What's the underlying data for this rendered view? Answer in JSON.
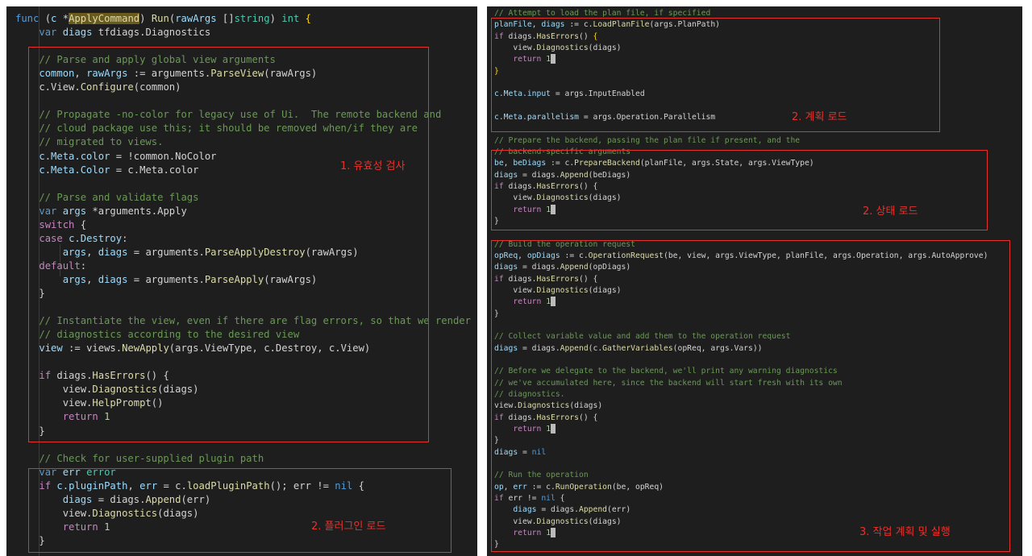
{
  "left_panel": {
    "lines": [
      [
        [
          "kw",
          "func"
        ],
        [
          "p",
          " ("
        ],
        [
          "var",
          "c"
        ],
        [
          "p",
          " *"
        ],
        [
          "hl",
          "ApplyCommand"
        ],
        [
          "p",
          ") "
        ],
        [
          "fn",
          "Run"
        ],
        [
          "p",
          "("
        ],
        [
          "var",
          "rawArgs"
        ],
        [
          "p",
          " []"
        ],
        [
          "type",
          "string"
        ],
        [
          "p",
          ") "
        ],
        [
          "type",
          "int"
        ],
        [
          "br",
          " {"
        ]
      ],
      [
        [
          "p",
          "    "
        ],
        [
          "kw",
          "var"
        ],
        [
          "p",
          " "
        ],
        [
          "var",
          "diags"
        ],
        [
          "p",
          " tfdiags.Diagnostics"
        ]
      ],
      [],
      [
        [
          "cmt",
          "    // Parse and apply global view arguments"
        ]
      ],
      [
        [
          "p",
          "    "
        ],
        [
          "var",
          "common"
        ],
        [
          "p",
          ", "
        ],
        [
          "var",
          "rawArgs"
        ],
        [
          "p",
          " := arguments."
        ],
        [
          "fn",
          "ParseView"
        ],
        [
          "p",
          "(rawArgs)"
        ]
      ],
      [
        [
          "p",
          "    c.View."
        ],
        [
          "fn",
          "Configure"
        ],
        [
          "p",
          "(common)"
        ]
      ],
      [],
      [
        [
          "cmt",
          "    // Propagate -no-color for legacy use of Ui.  The remote backend and"
        ]
      ],
      [
        [
          "cmt",
          "    // cloud package use this; it should be removed when/if they are"
        ]
      ],
      [
        [
          "cmt",
          "    // migrated to views."
        ]
      ],
      [
        [
          "p",
          "    "
        ],
        [
          "var",
          "c.Meta.color"
        ],
        [
          "p",
          " = !common.NoColor"
        ]
      ],
      [
        [
          "p",
          "    "
        ],
        [
          "var",
          "c.Meta.Color"
        ],
        [
          "p",
          " = c.Meta.color"
        ]
      ],
      [],
      [
        [
          "cmt",
          "    // Parse and validate flags"
        ]
      ],
      [
        [
          "p",
          "    "
        ],
        [
          "kw",
          "var"
        ],
        [
          "p",
          " "
        ],
        [
          "var",
          "args"
        ],
        [
          "p",
          " *arguments.Apply"
        ]
      ],
      [
        [
          "p",
          "    "
        ],
        [
          "ctl",
          "switch"
        ],
        [
          "p",
          " {"
        ]
      ],
      [
        [
          "p",
          "    "
        ],
        [
          "ctl",
          "case"
        ],
        [
          "p",
          " "
        ],
        [
          "var",
          "c.Destroy"
        ],
        [
          "p",
          ":"
        ]
      ],
      [
        [
          "p",
          "        "
        ],
        [
          "var",
          "args"
        ],
        [
          "p",
          ", "
        ],
        [
          "var",
          "diags"
        ],
        [
          "p",
          " = arguments."
        ],
        [
          "fn",
          "ParseApplyDestroy"
        ],
        [
          "p",
          "(rawArgs)"
        ]
      ],
      [
        [
          "p",
          "    "
        ],
        [
          "ctl",
          "default"
        ],
        [
          "p",
          ":"
        ]
      ],
      [
        [
          "p",
          "        "
        ],
        [
          "var",
          "args"
        ],
        [
          "p",
          ", "
        ],
        [
          "var",
          "diags"
        ],
        [
          "p",
          " = arguments."
        ],
        [
          "fn",
          "ParseApply"
        ],
        [
          "p",
          "(rawArgs)"
        ]
      ],
      [
        [
          "p",
          "    }"
        ]
      ],
      [],
      [
        [
          "cmt",
          "    // Instantiate the view, even if there are flag errors, so that we render"
        ]
      ],
      [
        [
          "cmt",
          "    // diagnostics according to the desired view"
        ]
      ],
      [
        [
          "p",
          "    "
        ],
        [
          "var",
          "view"
        ],
        [
          "p",
          " := views."
        ],
        [
          "fn",
          "NewApply"
        ],
        [
          "p",
          "(args.ViewType, c.Destroy, c.View)"
        ]
      ],
      [],
      [
        [
          "p",
          "    "
        ],
        [
          "ctl",
          "if"
        ],
        [
          "p",
          " diags."
        ],
        [
          "fn",
          "HasErrors"
        ],
        [
          "p",
          "() {"
        ]
      ],
      [
        [
          "p",
          "        view."
        ],
        [
          "fn",
          "Diagnostics"
        ],
        [
          "p",
          "(diags)"
        ]
      ],
      [
        [
          "p",
          "        view."
        ],
        [
          "fn",
          "HelpPrompt"
        ],
        [
          "p",
          "()"
        ]
      ],
      [
        [
          "p",
          "        "
        ],
        [
          "ctl",
          "return"
        ],
        [
          "p",
          " "
        ],
        [
          "num",
          "1"
        ]
      ],
      [
        [
          "p",
          "    }"
        ]
      ],
      [],
      [
        [
          "cmt",
          "    // Check for user-supplied plugin path"
        ]
      ],
      [
        [
          "p",
          "    "
        ],
        [
          "kw",
          "var"
        ],
        [
          "p",
          " "
        ],
        [
          "var",
          "err"
        ],
        [
          "p",
          " "
        ],
        [
          "type",
          "error"
        ]
      ],
      [
        [
          "p",
          "    "
        ],
        [
          "ctl",
          "if"
        ],
        [
          "p",
          " "
        ],
        [
          "var",
          "c.pluginPath"
        ],
        [
          "p",
          ", "
        ],
        [
          "var",
          "err"
        ],
        [
          "p",
          " = c."
        ],
        [
          "fn",
          "loadPluginPath"
        ],
        [
          "p",
          "(); err != "
        ],
        [
          "kw",
          "nil"
        ],
        [
          "p",
          " {"
        ]
      ],
      [
        [
          "p",
          "        "
        ],
        [
          "var",
          "diags"
        ],
        [
          "p",
          " = diags."
        ],
        [
          "fn",
          "Append"
        ],
        [
          "p",
          "(err)"
        ]
      ],
      [
        [
          "p",
          "        view."
        ],
        [
          "fn",
          "Diagnostics"
        ],
        [
          "p",
          "(diags)"
        ]
      ],
      [
        [
          "p",
          "        "
        ],
        [
          "ctl",
          "return"
        ],
        [
          "p",
          " "
        ],
        [
          "num",
          "1"
        ]
      ],
      [
        [
          "p",
          "    }"
        ]
      ]
    ],
    "annotations": [
      "1. 유효성 검사",
      "2. 플러그인 로드"
    ]
  },
  "right_panel": {
    "lines": [
      [
        [
          "cmt",
          "// Attempt to load the plan file, if specified"
        ]
      ],
      [
        [
          "var",
          "planFile"
        ],
        [
          "p",
          ", "
        ],
        [
          "var",
          "diags"
        ],
        [
          "p",
          " := c."
        ],
        [
          "fn",
          "LoadPlanFile"
        ],
        [
          "p",
          "(args.PlanPath)"
        ]
      ],
      [
        [
          "ctl",
          "if"
        ],
        [
          "p",
          " diags."
        ],
        [
          "fn",
          "HasErrors"
        ],
        [
          "p",
          "() "
        ],
        [
          "br",
          "{"
        ]
      ],
      [
        [
          "p",
          "    view."
        ],
        [
          "fn",
          "Diagnostics"
        ],
        [
          "p",
          "(diags)"
        ]
      ],
      [
        [
          "p",
          "    "
        ],
        [
          "ctl",
          "return"
        ],
        [
          "p",
          " "
        ],
        [
          "num",
          "1"
        ],
        [
          "caret",
          ""
        ]
      ],
      [
        [
          "br",
          "}"
        ]
      ],
      [],
      [
        [
          "var",
          "c.Meta.input"
        ],
        [
          "p",
          " = args.InputEnabled"
        ]
      ],
      [],
      [
        [
          "var",
          "c.Meta.parallelism"
        ],
        [
          "p",
          " = args.Operation.Parallelism"
        ]
      ],
      [],
      [
        [
          "cmt",
          "// Prepare the backend, passing the plan file if present, and the"
        ]
      ],
      [
        [
          "cmt",
          "// backend-specific arguments"
        ]
      ],
      [
        [
          "var",
          "be"
        ],
        [
          "p",
          ", "
        ],
        [
          "var",
          "beDiags"
        ],
        [
          "p",
          " := c."
        ],
        [
          "fn",
          "PrepareBackend"
        ],
        [
          "p",
          "(planFile, args.State, args.ViewType)"
        ]
      ],
      [
        [
          "var",
          "diags"
        ],
        [
          "p",
          " = diags."
        ],
        [
          "fn",
          "Append"
        ],
        [
          "p",
          "(beDiags)"
        ]
      ],
      [
        [
          "ctl",
          "if"
        ],
        [
          "p",
          " diags."
        ],
        [
          "fn",
          "HasErrors"
        ],
        [
          "p",
          "() {"
        ]
      ],
      [
        [
          "p",
          "    view."
        ],
        [
          "fn",
          "Diagnostics"
        ],
        [
          "p",
          "(diags)"
        ]
      ],
      [
        [
          "p",
          "    "
        ],
        [
          "ctl",
          "return"
        ],
        [
          "p",
          " "
        ],
        [
          "num",
          "1"
        ],
        [
          "caret",
          ""
        ]
      ],
      [
        [
          "p",
          "}"
        ]
      ],
      [],
      [
        [
          "cmt",
          "// Build the operation request"
        ]
      ],
      [
        [
          "var",
          "opReq"
        ],
        [
          "p",
          ", "
        ],
        [
          "var",
          "opDiags"
        ],
        [
          "p",
          " := c."
        ],
        [
          "fn",
          "OperationRequest"
        ],
        [
          "p",
          "(be, view, args.ViewType, planFile, args.Operation, args.AutoApprove)"
        ]
      ],
      [
        [
          "var",
          "diags"
        ],
        [
          "p",
          " = diags."
        ],
        [
          "fn",
          "Append"
        ],
        [
          "p",
          "(opDiags)"
        ]
      ],
      [
        [
          "ctl",
          "if"
        ],
        [
          "p",
          " diags."
        ],
        [
          "fn",
          "HasErrors"
        ],
        [
          "p",
          "() {"
        ]
      ],
      [
        [
          "p",
          "    view."
        ],
        [
          "fn",
          "Diagnostics"
        ],
        [
          "p",
          "(diags)"
        ]
      ],
      [
        [
          "p",
          "    "
        ],
        [
          "ctl",
          "return"
        ],
        [
          "p",
          " "
        ],
        [
          "num",
          "1"
        ],
        [
          "caret",
          ""
        ]
      ],
      [
        [
          "p",
          "}"
        ]
      ],
      [],
      [
        [
          "cmt",
          "// Collect variable value and add them to the operation request"
        ]
      ],
      [
        [
          "var",
          "diags"
        ],
        [
          "p",
          " = diags."
        ],
        [
          "fn",
          "Append"
        ],
        [
          "p",
          "(c."
        ],
        [
          "fn",
          "GatherVariables"
        ],
        [
          "p",
          "(opReq, args.Vars))"
        ]
      ],
      [],
      [
        [
          "cmt",
          "// Before we delegate to the backend, we'll print any warning diagnostics"
        ]
      ],
      [
        [
          "cmt",
          "// we've accumulated here, since the backend will start fresh with its own"
        ]
      ],
      [
        [
          "cmt",
          "// diagnostics."
        ]
      ],
      [
        [
          "p",
          "view."
        ],
        [
          "fn",
          "Diagnostics"
        ],
        [
          "p",
          "(diags)"
        ]
      ],
      [
        [
          "ctl",
          "if"
        ],
        [
          "p",
          " diags."
        ],
        [
          "fn",
          "HasErrors"
        ],
        [
          "p",
          "() {"
        ]
      ],
      [
        [
          "p",
          "    "
        ],
        [
          "ctl",
          "return"
        ],
        [
          "p",
          " "
        ],
        [
          "num",
          "1"
        ],
        [
          "caret",
          ""
        ]
      ],
      [
        [
          "p",
          "}"
        ]
      ],
      [
        [
          "var",
          "diags"
        ],
        [
          "p",
          " = "
        ],
        [
          "kw",
          "nil"
        ]
      ],
      [],
      [
        [
          "cmt",
          "// Run the operation"
        ]
      ],
      [
        [
          "var",
          "op"
        ],
        [
          "p",
          ", "
        ],
        [
          "var",
          "err"
        ],
        [
          "p",
          " := c."
        ],
        [
          "fn",
          "RunOperation"
        ],
        [
          "p",
          "(be, opReq)"
        ]
      ],
      [
        [
          "ctl",
          "if"
        ],
        [
          "p",
          " err != "
        ],
        [
          "kw",
          "nil"
        ],
        [
          "p",
          " {"
        ]
      ],
      [
        [
          "p",
          "    "
        ],
        [
          "var",
          "diags"
        ],
        [
          "p",
          " = diags."
        ],
        [
          "fn",
          "Append"
        ],
        [
          "p",
          "(err)"
        ]
      ],
      [
        [
          "p",
          "    view."
        ],
        [
          "fn",
          "Diagnostics"
        ],
        [
          "p",
          "(diags)"
        ]
      ],
      [
        [
          "p",
          "    "
        ],
        [
          "ctl",
          "return"
        ],
        [
          "p",
          " "
        ],
        [
          "num",
          "1"
        ],
        [
          "caret",
          ""
        ]
      ],
      [
        [
          "p",
          "}"
        ]
      ]
    ],
    "annotations": [
      "2. 계획 로드",
      "2. 상태 로드",
      "3. 작업 계획 및  실행"
    ]
  },
  "colors": {
    "background": "#1e1e1e",
    "annotation_red": "#e5322d",
    "keyword": "#569cd6",
    "control": "#c586c0",
    "function": "#dcdcaa",
    "variable": "#9cdcfe",
    "type": "#4ec9b0",
    "number": "#b5cea8",
    "comment": "#6a9955",
    "plain": "#d4d4d4"
  }
}
